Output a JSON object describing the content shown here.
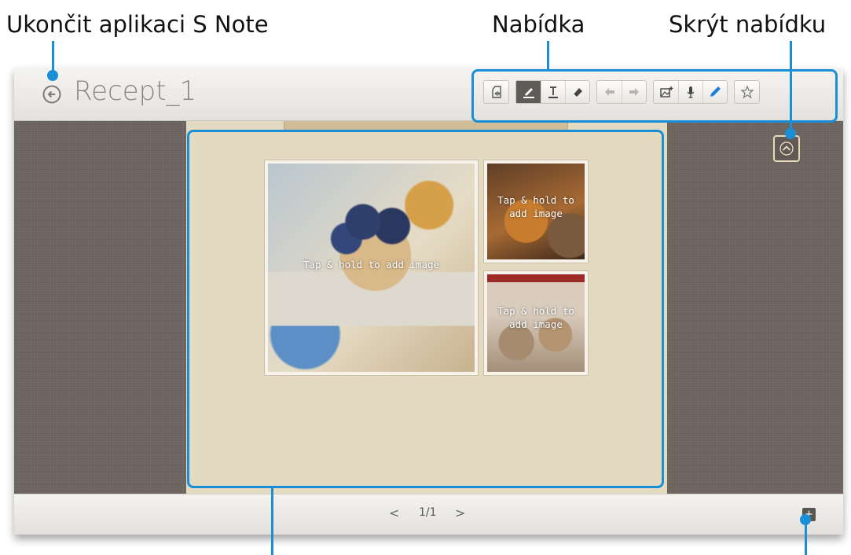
{
  "callouts": {
    "exit_app": "Ukončit aplikaci S Note",
    "menu": "Nabídka",
    "hide_menu": "Skrýt nabídku"
  },
  "app": {
    "document_title": "Recept_1",
    "toolbar": {
      "groups": [
        [
          "template-icon"
        ],
        [
          "pen-icon",
          "text-icon",
          "eraser-icon"
        ],
        [
          "undo-icon",
          "redo-icon"
        ],
        [
          "insert-image-icon",
          "voice-icon",
          "pencil-icon"
        ],
        [
          "star-icon"
        ]
      ],
      "active_tool": "pen-icon"
    },
    "page": {
      "placeholders": {
        "main": "Tap & hold to add image",
        "top_right": "Tap & hold to\nadd image",
        "bottom_right": "Tap & hold to\nadd image"
      }
    },
    "pagination": {
      "prev": "<",
      "indicator": "1/1",
      "next": ">"
    },
    "add_page_label": "+"
  },
  "colors": {
    "callout_blue": "#1a8fd6",
    "canvas_bg": "#6e6561",
    "page_bg": "#e4dac2"
  }
}
